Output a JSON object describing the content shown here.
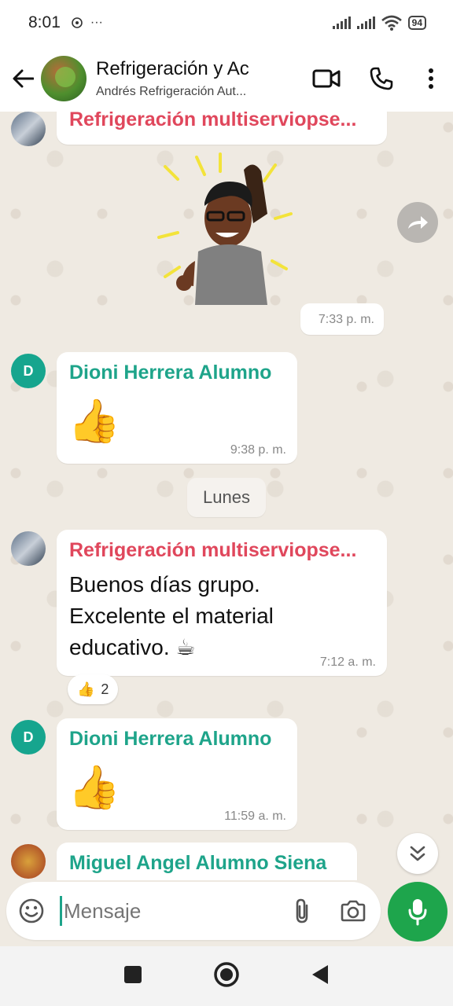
{
  "status_bar": {
    "time": "8:01",
    "extra": "···",
    "battery": "94"
  },
  "header": {
    "title": "Refrigeración y Ac",
    "subtitle": "Andrés Refrigeración Aut..."
  },
  "messages": [
    {
      "sender": "Refrigeración multiserviopse...",
      "sticker": "celebration-avatar",
      "time": "7:33 p. m."
    },
    {
      "sender": "Dioni Herrera Alumno",
      "avatar_letter": "D",
      "emoji": "👍",
      "time": "9:38 p. m."
    },
    {
      "sender": "Refrigeración multiserviopse...",
      "text": "Buenos días grupo. Excelente el material educativo. ☕",
      "time": "7:12 a. m.",
      "reaction": {
        "emoji": "👍",
        "count": "2"
      }
    },
    {
      "sender": "Dioni Herrera Alumno",
      "avatar_letter": "D",
      "emoji": "👍",
      "time": "11:59 a. m."
    },
    {
      "sender": "Miguel Angel Alumno Siena"
    }
  ],
  "date_separator": "Lunes",
  "composer": {
    "placeholder": "Mensaje"
  },
  "colors": {
    "accent": "#1ea48a",
    "mic": "#1ea54c",
    "sender_red": "#e0475c",
    "chat_bg": "#efeae2"
  },
  "icons": [
    "back-arrow-icon",
    "video-call-icon",
    "phone-icon",
    "more-vert-icon",
    "forward-icon",
    "scroll-down-icon",
    "emoji-icon",
    "attach-icon",
    "camera-icon",
    "mic-icon",
    "nav-recents-icon",
    "nav-home-icon",
    "nav-back-icon"
  ]
}
